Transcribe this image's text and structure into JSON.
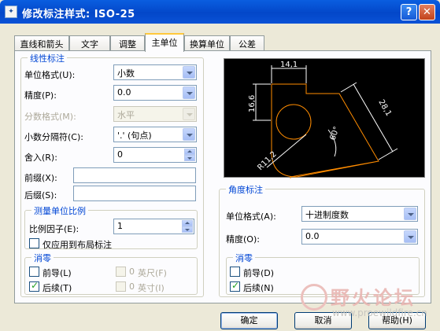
{
  "window": {
    "title": "修改标注样式: ISO-25",
    "help_label": "?",
    "close_label": "✕"
  },
  "tabs": [
    {
      "label": "直线和箭头"
    },
    {
      "label": "文字"
    },
    {
      "label": "调整"
    },
    {
      "label": "主单位"
    },
    {
      "label": "换算单位"
    },
    {
      "label": "公差"
    }
  ],
  "linear": {
    "title": "线性标注",
    "unit_format_label": "单位格式(U):",
    "unit_format_value": "小数",
    "precision_label": "精度(P):",
    "precision_value": "0.0",
    "fraction_label": "分数格式(M):",
    "fraction_value": "水平",
    "decimal_sep_label": "小数分隔符(C):",
    "decimal_sep_value": "'.' (句点)",
    "round_label": "舍入(R):",
    "round_value": "0",
    "prefix_label": "前缀(X):",
    "prefix_value": "",
    "suffix_label": "后缀(S):",
    "suffix_value": ""
  },
  "scale": {
    "title": "测量单位比例",
    "factor_label": "比例因子(E):",
    "factor_value": "1",
    "layout_only_label": "仅应用到布局标注"
  },
  "zero_linear": {
    "title": "消零",
    "leading_label": "前导(L)",
    "trailing_label": "后续(T)",
    "feet_value": "0",
    "feet_label": "英尺(F)",
    "inches_value": "0",
    "inches_label": "英寸(I)"
  },
  "preview": {
    "dims": {
      "d1": "14,1",
      "d2": "16,6",
      "d3": "28,1",
      "d4": "60°",
      "d5": "R11,2"
    },
    "colors": {
      "background": "#000000",
      "geometry": "#ff8c00",
      "dimension": "#ffffff"
    }
  },
  "angular": {
    "title": "角度标注",
    "unit_format_label": "单位格式(A):",
    "unit_format_value": "十进制度数",
    "precision_label": "精度(O):",
    "precision_value": "0.0"
  },
  "zero_angular": {
    "title": "消零",
    "leading_label": "前导(D)",
    "trailing_label": "后续(N)"
  },
  "buttons": {
    "ok": "确定",
    "cancel": "取消",
    "help": "帮助(H)"
  },
  "watermark": {
    "text": "野火论坛",
    "url": "www.proewildfire.cn"
  }
}
